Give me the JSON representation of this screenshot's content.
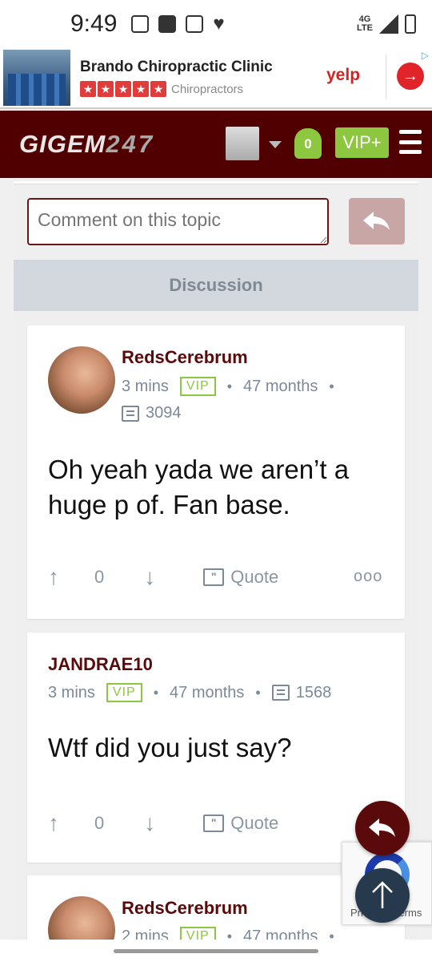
{
  "status_bar": {
    "time": "9:49",
    "network": "4G LTE"
  },
  "ad": {
    "title": "Brando Chiropractic Clinic",
    "category": "Chiropractors",
    "brand": "yelp",
    "stars": 5,
    "star_color": "#e03c3c"
  },
  "header": {
    "logo_text": "GIGEM",
    "logo_number": "247",
    "notification_count": "0",
    "vip_label": "VIP+",
    "bg_color": "#500000",
    "accent_color": "#8dc63f"
  },
  "comment": {
    "placeholder": "Comment on this topic"
  },
  "discussion": {
    "heading": "Discussion"
  },
  "posts": [
    {
      "username": "RedsCerebrum",
      "time": "3 mins",
      "badge": "VIP",
      "tenure": "47 months",
      "comment_count": "3094",
      "body": "Oh yeah yada we aren’t a huge p of. Fan base.",
      "score": "0",
      "quote_label": "Quote",
      "more": "ooo"
    },
    {
      "username": "JANDRAE10",
      "time": "3 mins",
      "badge": "VIP",
      "tenure": "47 months",
      "comment_count": "1568",
      "body": "Wtf did you just say?",
      "score": "0",
      "quote_label": "Quote"
    },
    {
      "username": "RedsCerebrum",
      "time": "2 mins",
      "badge": "VIP",
      "tenure": "47 months"
    }
  ],
  "recaptcha": {
    "text": "Privacy - Terms"
  }
}
